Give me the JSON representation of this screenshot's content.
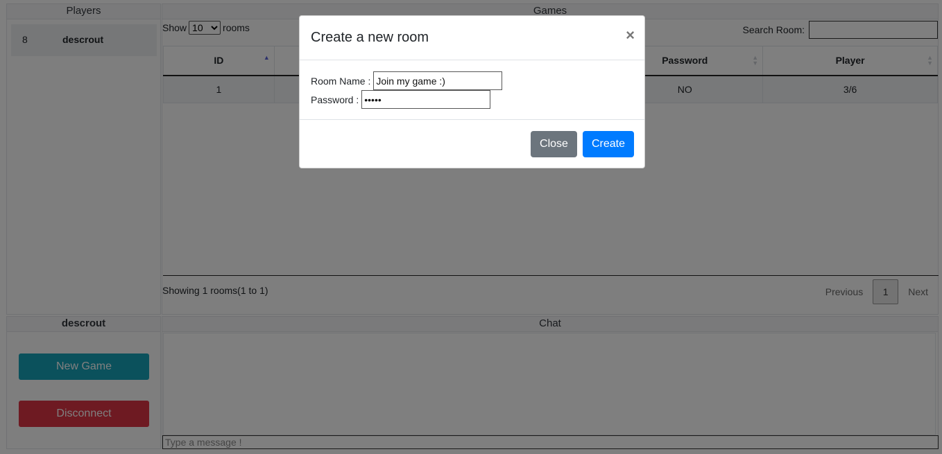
{
  "players": {
    "title": "Players",
    "items": [
      {
        "id": "8",
        "name": "descrout"
      }
    ]
  },
  "games": {
    "title": "Games",
    "show_prefix": "Show",
    "show_value": "10",
    "show_suffix": "rooms",
    "search_label": "Search Room:",
    "search_value": "",
    "columns": [
      {
        "label": "ID",
        "sort": "asc"
      },
      {
        "label": "",
        "sort": "none"
      },
      {
        "label": "",
        "sort": "none"
      },
      {
        "label": "Password",
        "sort": "none"
      },
      {
        "label": "Player",
        "sort": "none"
      }
    ],
    "rows": [
      [
        "1",
        "",
        "",
        "NO",
        "3/6"
      ]
    ],
    "showing_text": "Showing 1 rooms(1 to 1)",
    "pager": {
      "previous": "Previous",
      "current": "1",
      "next": "Next"
    }
  },
  "actions": {
    "title": "descrout",
    "new_game": "New Game",
    "disconnect": "Disconnect"
  },
  "chat": {
    "title": "Chat",
    "placeholder": "Type a message !"
  },
  "modal": {
    "title": "Create a new room",
    "close_symbol": "×",
    "room_name_label": "Room Name :",
    "room_name_value": "Join my game :)",
    "password_label": "Password :",
    "password_value": "•••••",
    "close_label": "Close",
    "create_label": "Create"
  }
}
